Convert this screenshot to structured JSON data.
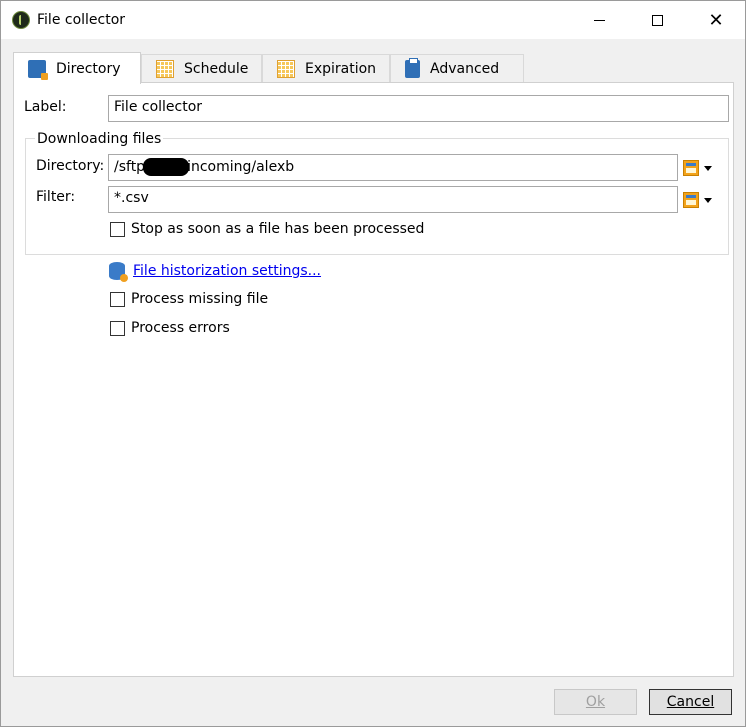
{
  "window": {
    "title": "File collector",
    "controls": {
      "minimize": "—",
      "maximize": "☐",
      "close": "✕"
    }
  },
  "tabs": [
    {
      "label": "Directory",
      "icon": "folder-download-icon",
      "active": true
    },
    {
      "label": "Schedule",
      "icon": "calendar-icon",
      "active": false
    },
    {
      "label": "Expiration",
      "icon": "calendar-icon",
      "active": false
    },
    {
      "label": "Advanced",
      "icon": "clipboard-icon",
      "active": false
    }
  ],
  "form": {
    "label_caption": "Label:",
    "label_value": "File collector",
    "group_title": "Downloading files",
    "directory_caption": "Directory:",
    "directory_value_start": "/sftp",
    "directory_value_end": "incoming/alexb",
    "filter_caption": "Filter:",
    "filter_value": "*.csv",
    "stop_checkbox": "Stop as soon as a file has been processed",
    "historization_link": "File historization settings...",
    "process_missing": "Process missing file",
    "process_errors": "Process errors"
  },
  "buttons": {
    "ok": "Ok",
    "cancel": "Cancel"
  },
  "colors": {
    "link": "#0000ee",
    "accent_orange": "#f2a31b",
    "accent_blue": "#2f6fb6"
  }
}
